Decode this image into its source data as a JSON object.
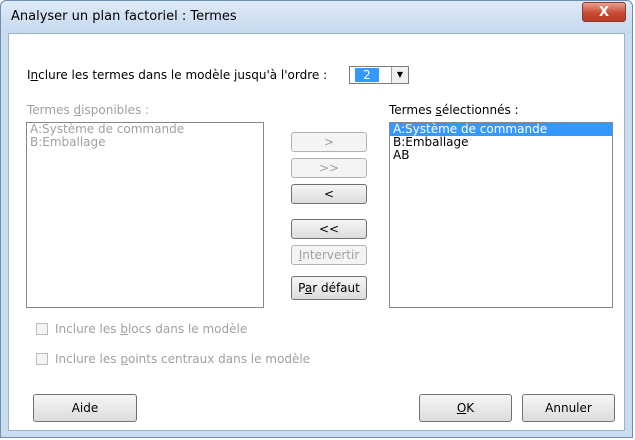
{
  "window": {
    "title": "Analyser un plan factoriel : Termes",
    "close_glyph": "X"
  },
  "order": {
    "label_pre": "I",
    "label_accel": "n",
    "label_post": "clure les termes dans le modèle jusqu'à l'ordre :",
    "value": "2",
    "arrow_glyph": "▼"
  },
  "available": {
    "label_pre": "Termes ",
    "label_accel": "d",
    "label_post": "isponibles :",
    "items": [
      "A:Système de commande",
      "B:Emballage"
    ]
  },
  "selected": {
    "label_pre": "Termes ",
    "label_accel": "s",
    "label_post": "électionnés :",
    "items": [
      "A:Système de commande",
      "B:Emballage",
      "AB"
    ],
    "selected_index": 0
  },
  "buttons": {
    "add": ">",
    "add_all": ">>",
    "remove": "<",
    "remove_all": "<<",
    "interchange_accel": "I",
    "interchange_rest": "ntervertir",
    "default_pre": "P",
    "default_accel": "a",
    "default_post": "r défaut",
    "help": "Aide",
    "ok_accel": "O",
    "ok_rest": "K",
    "cancel": "Annuler"
  },
  "options": {
    "blocks_pre": "Inclure les ",
    "blocks_accel": "b",
    "blocks_post": "locs dans le modèle",
    "center_pre": "Inclure les ",
    "center_accel": "p",
    "center_post": "oints centraux dans le modèle"
  }
}
